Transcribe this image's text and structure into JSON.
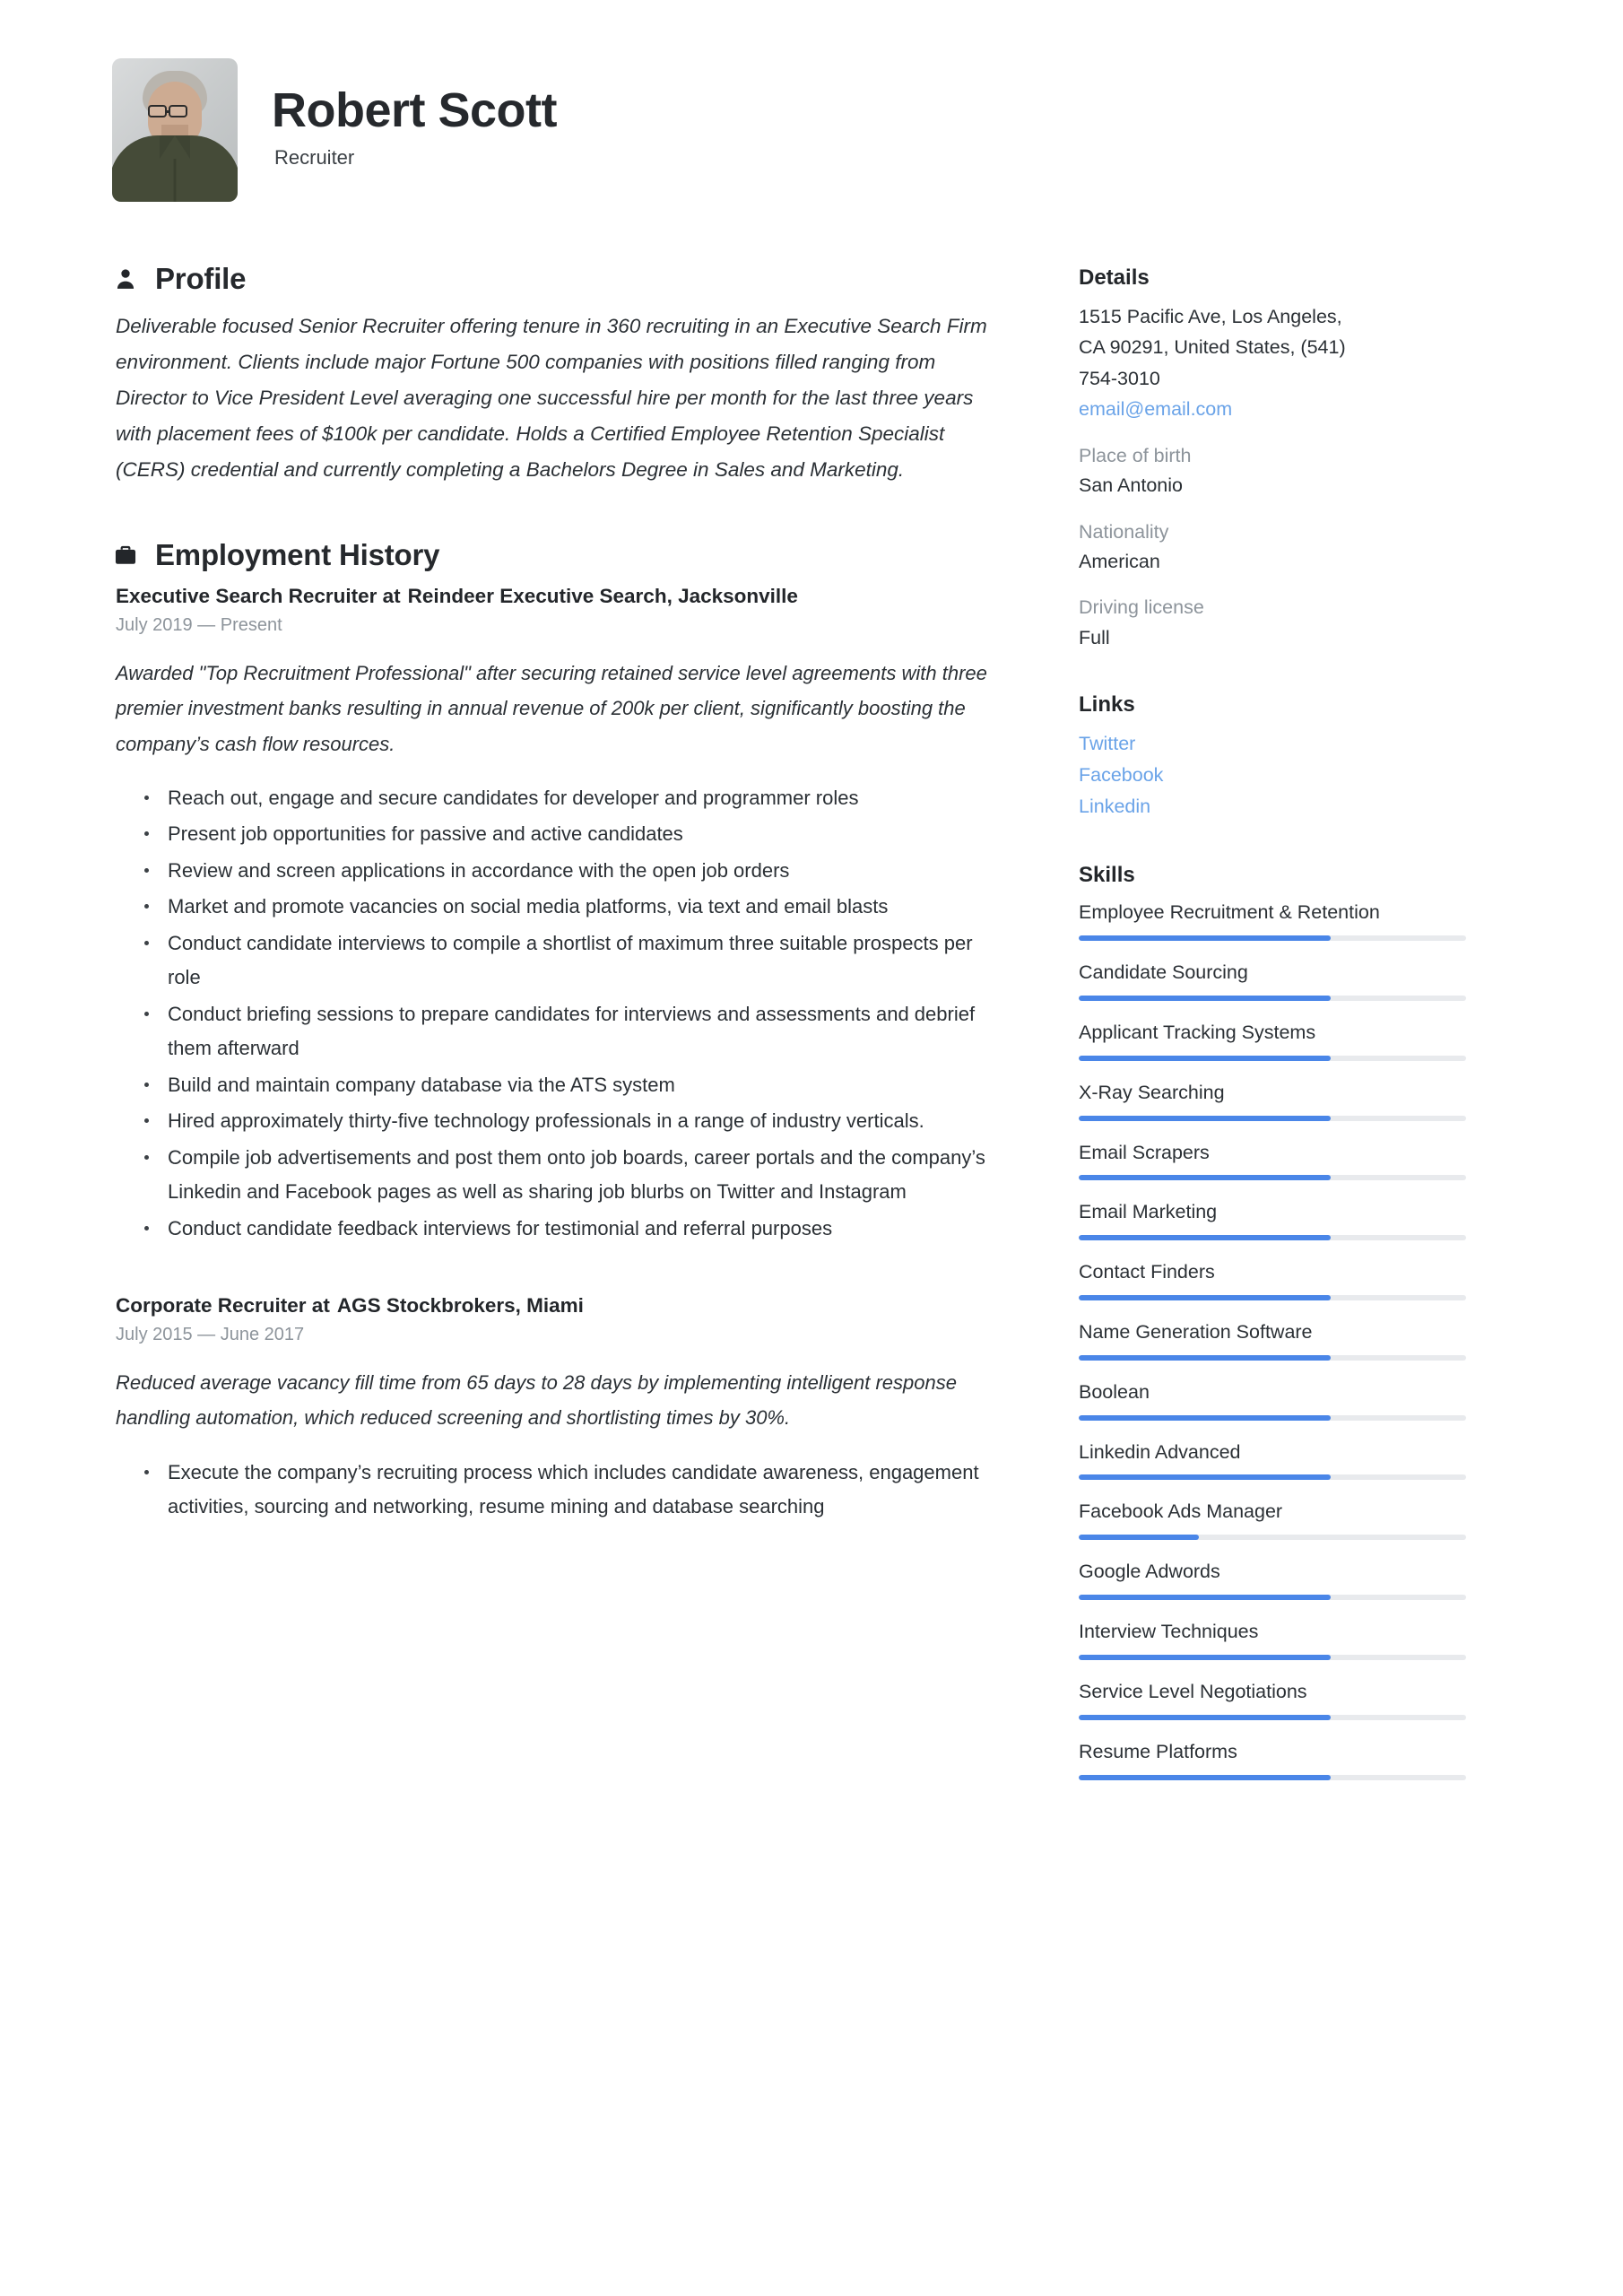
{
  "header": {
    "name": "Robert Scott",
    "title": "Recruiter",
    "photo_alt": "portrait-photo"
  },
  "profile": {
    "heading": "Profile",
    "icon": "person-icon",
    "text": "Deliverable focused Senior Recruiter offering tenure in 360 recruiting in an Executive Search Firm environment. Clients include major Fortune 500 companies with positions filled ranging from Director to Vice President Level averaging one successful hire per month for the last three years with placement fees of $100k per candidate. Holds a Certified Employee Retention Specialist (CERS) credential and currently completing a Bachelors Degree in Sales and Marketing."
  },
  "employment": {
    "heading": "Employment History",
    "icon": "briefcase-icon",
    "jobs": [
      {
        "role": "Executive Search Recruiter at",
        "company": "Reindeer Executive Search, Jacksonville",
        "dates": "July 2019 — Present",
        "summary": "Awarded \"Top Recruitment Professional\" after securing retained service level agreements with three premier investment banks resulting in annual revenue of 200k per client, significantly boosting the company’s cash flow resources.",
        "bullets": [
          "Reach out, engage and secure candidates for developer and programmer roles",
          "Present job opportunities for passive and active candidates",
          "Review and screen applications in accordance with the open job orders",
          "Market and promote vacancies on social media platforms, via text and email blasts",
          "Conduct candidate interviews to compile a shortlist of maximum three suitable prospects per role",
          "Conduct briefing sessions to prepare candidates for interviews and assessments and debrief them afterward",
          "Build and maintain company database via the ATS system",
          "Hired approximately thirty-five technology professionals in a range of industry verticals.",
          "Compile job advertisements and post them onto job boards, career portals and the company’s Linkedin and Facebook pages as well as sharing job blurbs on Twitter and Instagram",
          "Conduct candidate feedback interviews for testimonial and referral purposes"
        ]
      },
      {
        "role": "Corporate Recruiter at",
        "company": "AGS Stockbrokers, Miami",
        "dates": "July 2015 — June 2017",
        "summary": "Reduced average vacancy fill time from 65 days to 28 days by implementing intelligent response handling automation, which reduced screening and shortlisting times by 30%.",
        "bullets": [
          "Execute the company’s recruiting process which includes candidate awareness, engagement activities, sourcing and networking, resume mining and database searching"
        ]
      }
    ]
  },
  "details": {
    "heading": "Details",
    "address_lines": [
      "1515 Pacific Ave, Los Angeles,",
      "CA 90291, United States, (541)",
      "754-3010"
    ],
    "email": "email@email.com",
    "fields": [
      {
        "label": "Place of birth",
        "value": "San Antonio"
      },
      {
        "label": "Nationality",
        "value": "American"
      },
      {
        "label": "Driving license",
        "value": "Full"
      }
    ]
  },
  "links": {
    "heading": "Links",
    "items": [
      "Twitter",
      "Facebook",
      "Linkedin"
    ]
  },
  "skills": {
    "heading": "Skills",
    "items": [
      {
        "name": "Employee Recruitment & Retention",
        "level": 65
      },
      {
        "name": "Candidate Sourcing",
        "level": 65
      },
      {
        "name": "Applicant Tracking Systems",
        "level": 65
      },
      {
        "name": "X-Ray Searching",
        "level": 65
      },
      {
        "name": "Email Scrapers",
        "level": 65
      },
      {
        "name": "Email Marketing",
        "level": 65
      },
      {
        "name": "Contact Finders",
        "level": 65
      },
      {
        "name": "Name Generation Software",
        "level": 65
      },
      {
        "name": "Boolean",
        "level": 65
      },
      {
        "name": "Linkedin Advanced",
        "level": 65
      },
      {
        "name": "Facebook Ads Manager",
        "level": 31
      },
      {
        "name": "Google Adwords",
        "level": 65
      },
      {
        "name": "Interview Techniques",
        "level": 65
      },
      {
        "name": "Service Level Negotiations",
        "level": 65
      },
      {
        "name": "Resume Platforms",
        "level": 65
      }
    ]
  },
  "colors": {
    "accent_blue": "#4a86e8",
    "link_blue": "#6aa3e8",
    "track_gray": "#e8eaed",
    "text_dark": "#2b3035",
    "text_muted": "#8d949b"
  }
}
